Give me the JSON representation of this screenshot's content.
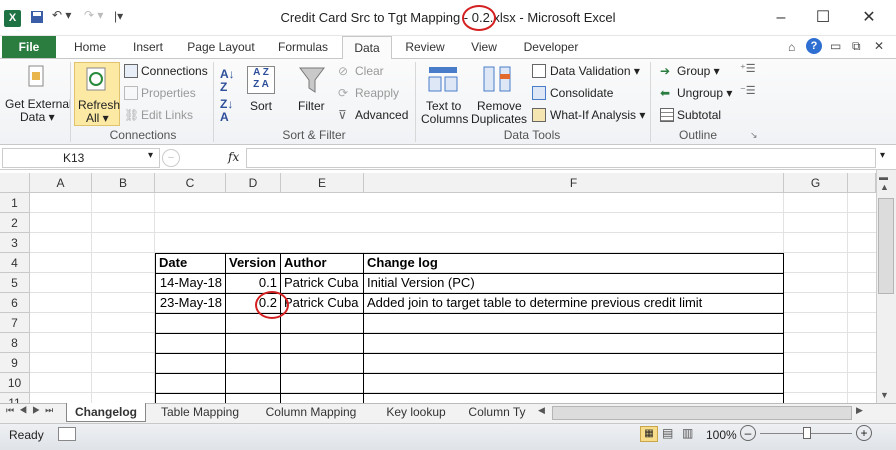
{
  "window": {
    "title": "Credit Card Src to Tgt Mapping - 0.2.xlsx - Microsoft Excel"
  },
  "ribbon_tabs": [
    "File",
    "Home",
    "Insert",
    "Page Layout",
    "Formulas",
    "Data",
    "Review",
    "View",
    "Developer"
  ],
  "ribbon": {
    "get_external": {
      "line1": "Get External",
      "line2": "Data ▾"
    },
    "refresh": {
      "line1": "Refresh",
      "line2": "All ▾"
    },
    "connections": "Connections",
    "properties": "Properties",
    "edit_links": "Edit Links",
    "group_connections": "Connections",
    "sort": "Sort",
    "filter": "Filter",
    "clear": "Clear",
    "reapply": "Reapply",
    "advanced": "Advanced",
    "group_sort_filter": "Sort & Filter",
    "text_to_columns": {
      "line1": "Text to",
      "line2": "Columns"
    },
    "remove_duplicates": {
      "line1": "Remove",
      "line2": "Duplicates"
    },
    "data_validation": "Data Validation ▾",
    "consolidate": "Consolidate",
    "what_if": "What-If Analysis ▾",
    "group_data_tools": "Data Tools",
    "group": "Group ▾",
    "ungroup": "Ungroup ▾",
    "subtotal": "Subtotal",
    "group_outline": "Outline"
  },
  "formula_bar": {
    "name_box": "K13",
    "fx": "fx",
    "formula": ""
  },
  "columns": [
    "A",
    "B",
    "C",
    "D",
    "E",
    "F",
    "G"
  ],
  "rows": [
    "1",
    "2",
    "3",
    "4",
    "5",
    "6",
    "7",
    "8",
    "9",
    "10",
    "11"
  ],
  "table": {
    "headers": [
      "Date",
      "Version",
      "Author",
      "Change log"
    ],
    "data": [
      [
        "14-May-18",
        "0.1",
        "Patrick Cuba",
        "Initial Version (PC)"
      ],
      [
        "23-May-18",
        "0.2",
        "Patrick Cuba",
        "Added join to target table to determine previous credit limit"
      ]
    ]
  },
  "sheets": [
    "Changelog",
    "Table Mapping",
    "Column Mapping",
    "Key lookup",
    "Column Ty"
  ],
  "status": {
    "mode": "Ready",
    "zoom": "100%"
  },
  "colors": {
    "excel_green": "#2a7c3f",
    "annotation_red": "#d42020"
  }
}
